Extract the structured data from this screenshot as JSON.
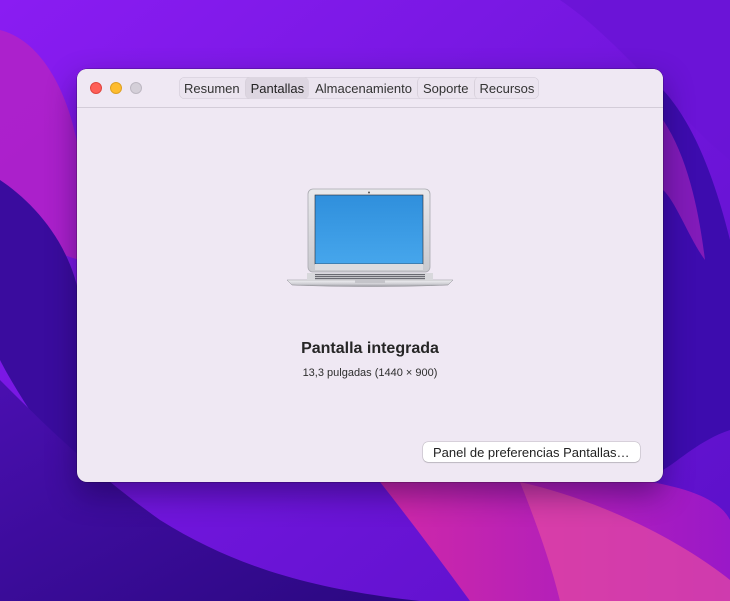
{
  "window": {
    "tabs": [
      {
        "label": "Resumen",
        "active": false
      },
      {
        "label": "Pantallas",
        "active": true
      },
      {
        "label": "Almacenamiento",
        "active": false
      },
      {
        "label": "Soporte",
        "active": false
      },
      {
        "label": "Recursos",
        "active": false
      }
    ]
  },
  "display": {
    "name": "Pantalla integrada",
    "details": "13,3 pulgadas (1440 × 900)"
  },
  "preferences_button_label": "Panel de preferencias Pantallas…",
  "colors": {
    "window_bg": "#efe8f3",
    "close": "#fe5f57",
    "minimize": "#febc2e",
    "zoom_inactive": "#d4cfd8",
    "screen_blue": "#3c9be3"
  }
}
